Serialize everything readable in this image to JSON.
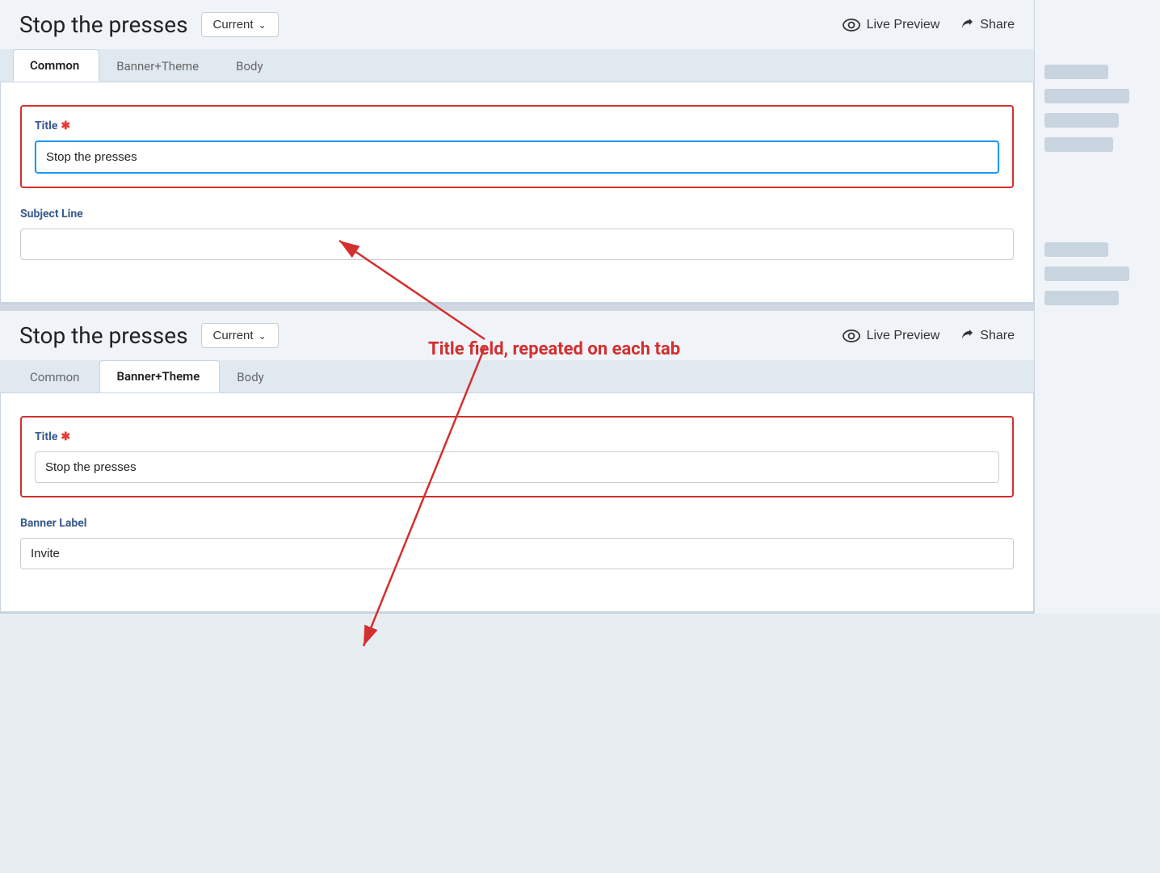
{
  "panels": [
    {
      "id": "panel-top",
      "title": "Stop the presses",
      "version_label": "Current",
      "live_preview_label": "Live Preview",
      "share_label": "Share",
      "tabs": [
        {
          "id": "common",
          "label": "Common",
          "active": true
        },
        {
          "id": "banner-theme",
          "label": "Banner+Theme",
          "active": false
        },
        {
          "id": "body",
          "label": "Body",
          "active": false
        }
      ],
      "fields": [
        {
          "id": "title-field",
          "label": "Title",
          "required": true,
          "value": "Stop the presses",
          "focused": true,
          "in_red_box": true
        },
        {
          "id": "subject-line-field",
          "label": "Subject Line",
          "required": false,
          "value": "",
          "focused": false,
          "in_red_box": false
        }
      ]
    },
    {
      "id": "panel-bottom",
      "title": "Stop the presses",
      "version_label": "Current",
      "live_preview_label": "Live Preview",
      "share_label": "Share",
      "tabs": [
        {
          "id": "common",
          "label": "Common",
          "active": false
        },
        {
          "id": "banner-theme",
          "label": "Banner+Theme",
          "active": true
        },
        {
          "id": "body",
          "label": "Body",
          "active": false
        }
      ],
      "fields": [
        {
          "id": "title-field",
          "label": "Title",
          "required": true,
          "value": "Stop the presses",
          "focused": false,
          "in_red_box": true
        },
        {
          "id": "banner-label-field",
          "label": "Banner Label",
          "required": false,
          "value": "Invite",
          "focused": false,
          "in_red_box": false
        }
      ]
    }
  ],
  "annotation": {
    "text": "Title field, repeated on each tab"
  },
  "side_stubs": {
    "top": [
      "S",
      "R",
      "B",
      "B"
    ],
    "bottom": [
      "S",
      "R",
      "B"
    ]
  }
}
